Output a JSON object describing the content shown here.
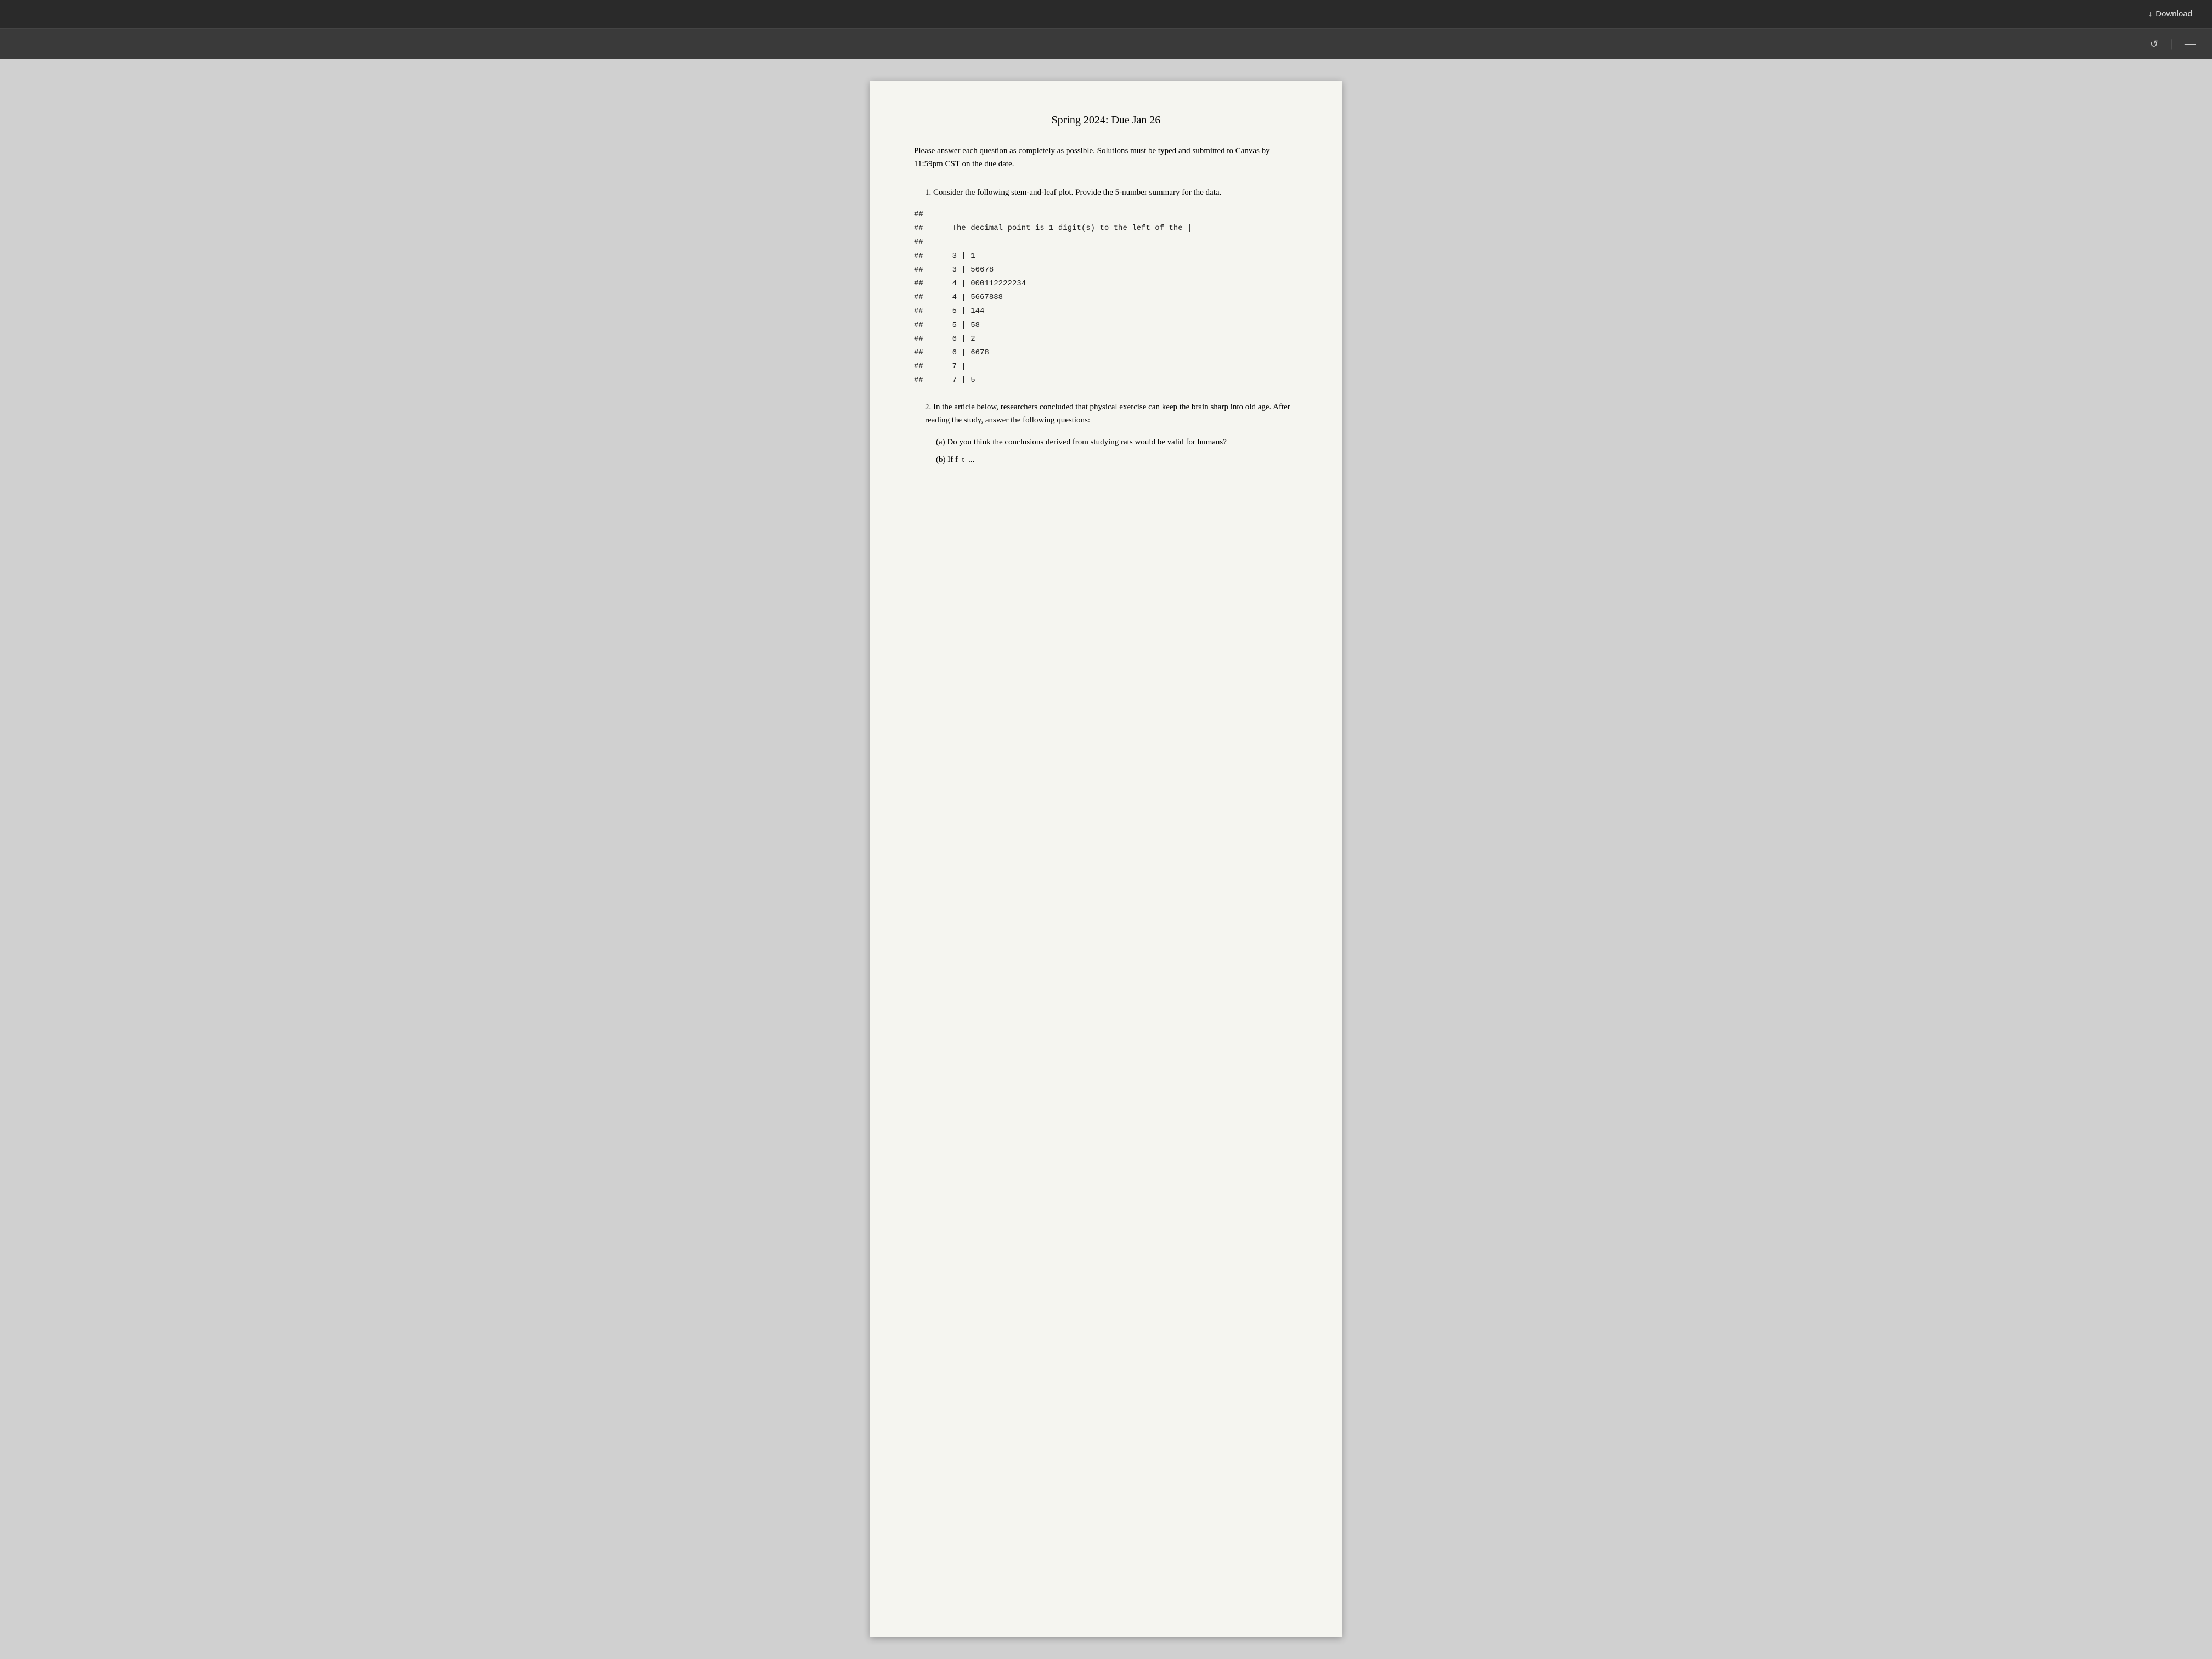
{
  "topbar": {
    "download_label": "Download",
    "download_icon": "↓"
  },
  "toolbar": {
    "refresh_icon": "↺",
    "divider": "|",
    "minimize_icon": "—"
  },
  "document": {
    "title": "Spring 2024:  Due Jan 26",
    "instructions": "Please answer each question as completely as possible.  Solutions must be typed and submitted to Canvas by 11:59pm CST on the due date.",
    "question1": {
      "number": "1.",
      "text": "Consider the following stem-and-leaf plot.  Provide the 5-number summary for the data."
    },
    "stem_leaf": {
      "lines": [
        {
          "prefix": "##",
          "content": ""
        },
        {
          "prefix": "##",
          "content": "    The decimal point is 1 digit(s) to the left of the |"
        },
        {
          "prefix": "##",
          "content": ""
        },
        {
          "prefix": "##",
          "content": "    3 | 1"
        },
        {
          "prefix": "##",
          "content": "    3 | 56678"
        },
        {
          "prefix": "##",
          "content": "    4 | 000112222234"
        },
        {
          "prefix": "##",
          "content": "    4 | 5667888"
        },
        {
          "prefix": "##",
          "content": "    5 | 144"
        },
        {
          "prefix": "##",
          "content": "    5 | 58"
        },
        {
          "prefix": "##",
          "content": "    6 | 2"
        },
        {
          "prefix": "##",
          "content": "    6 | 6678"
        },
        {
          "prefix": "##",
          "content": "    7 |"
        },
        {
          "prefix": "##",
          "content": "    7 | 5"
        }
      ]
    },
    "question2": {
      "number": "2.",
      "text": "In the article below, researchers concluded that physical exercise can keep the brain sharp into old age.  After reading the study, answer the following questions:"
    },
    "question2a": {
      "label": "(a)",
      "text": "Do you think the conclusions derived from studying rats would be valid for humans?"
    },
    "question2b_partial": {
      "label": "(b)",
      "text": "If f t ..."
    }
  }
}
